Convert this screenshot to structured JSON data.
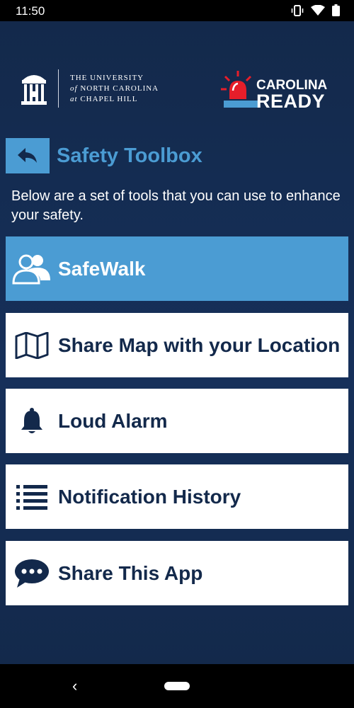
{
  "status_bar": {
    "time": "11:50"
  },
  "logos": {
    "unc_line1": "THE UNIVERSITY",
    "unc_line2_italic": "of",
    "unc_line2": "NORTH CAROLINA",
    "unc_line3_italic": "at",
    "unc_line3": "CHAPEL HILL",
    "carolina_ready_line1": "CAROLINA",
    "carolina_ready_line2": "READY"
  },
  "header": {
    "title": "Safety Toolbox"
  },
  "description": "Below are a set of tools that you can use to enhance your safety.",
  "tools": [
    {
      "label": "SafeWalk",
      "icon": "people-icon"
    },
    {
      "label": "Share Map with your Location",
      "icon": "map-icon"
    },
    {
      "label": "Loud Alarm",
      "icon": "bell-icon"
    },
    {
      "label": "Notification History",
      "icon": "list-icon"
    },
    {
      "label": "Share This App",
      "icon": "chat-icon"
    }
  ],
  "colors": {
    "background": "#13294b",
    "accent": "#4b9cd3",
    "card": "#ffffff",
    "alert_red": "#e61e2a"
  }
}
